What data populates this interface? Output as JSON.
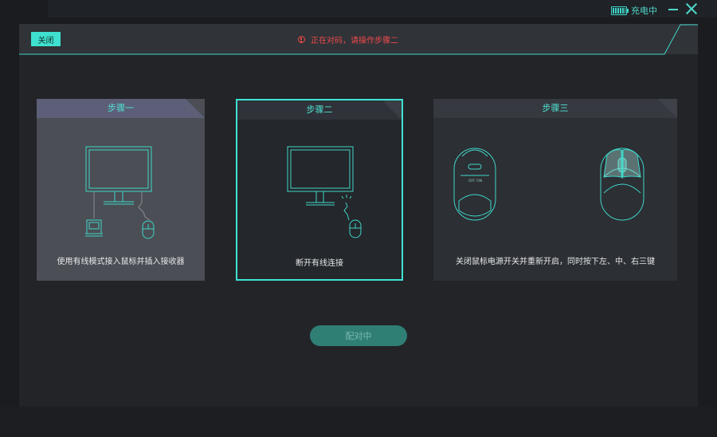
{
  "titlebar": {
    "charging_label": "充电中",
    "accent": "#4fd8ca"
  },
  "dialog": {
    "close_label": "关闭",
    "warning_text": "正在对码，请操作步骤二",
    "warning_color": "#ec4a4a",
    "pair_button_label": "配对中"
  },
  "steps": [
    {
      "title": "步骤一",
      "text": "使用有线模式接入鼠标并插入接收器"
    },
    {
      "title": "步骤二",
      "text": "断开有线连接"
    },
    {
      "title": "步骤三",
      "text": "关闭鼠标电源开关并重新开启，同时按下左、中、右三键"
    }
  ],
  "icons": {
    "battery": "battery-icon",
    "minimize": "minimize-icon",
    "close": "close-icon",
    "warning": "warning-icon",
    "monitor": "monitor-icon",
    "mouse": "mouse-icon",
    "receiver": "usb-receiver-icon"
  },
  "mouse_switch_label": "OFF ON"
}
